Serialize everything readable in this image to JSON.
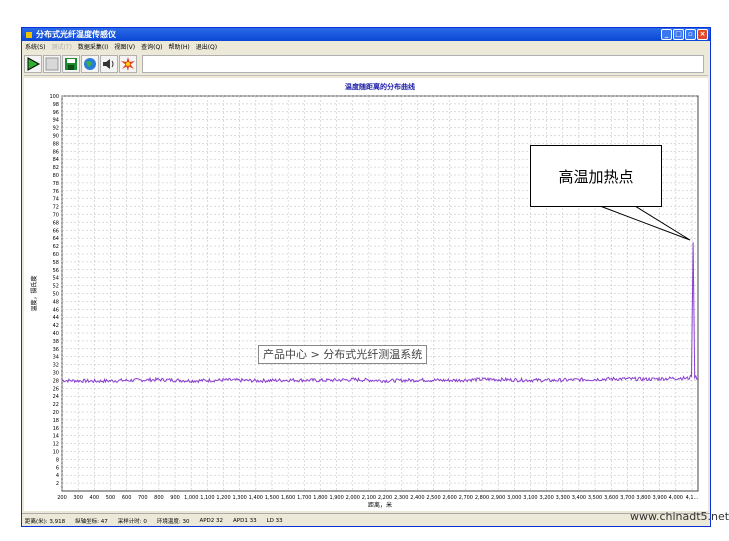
{
  "window": {
    "title": "分布式光纤温度传感仪"
  },
  "menu": [
    {
      "label": "系统(S)",
      "disabled": false
    },
    {
      "label": "测试(T)",
      "disabled": true
    },
    {
      "label": "数据采集(I)",
      "disabled": false
    },
    {
      "label": "视图(V)",
      "disabled": false
    },
    {
      "label": "查询(Q)",
      "disabled": false
    },
    {
      "label": "帮助(H)",
      "disabled": false
    },
    {
      "label": "退出(Q)",
      "disabled": false
    }
  ],
  "toolbar": {
    "buttons": [
      {
        "icon": "play-icon"
      },
      {
        "icon": "stop-icon"
      },
      {
        "icon": "save-icon"
      },
      {
        "icon": "globe-icon"
      },
      {
        "icon": "speaker-icon"
      },
      {
        "icon": "burst-icon"
      }
    ]
  },
  "chart_data": {
    "type": "line",
    "title": "温度随距离的分布曲线",
    "xlabel": "距离，米",
    "ylabel": "温度，摄氏度",
    "xlim": [
      200,
      4100
    ],
    "ylim": [
      0,
      100
    ],
    "x_ticks": [
      "200",
      "300",
      "400",
      "500",
      "600",
      "700",
      "800",
      "900",
      "1,000",
      "1,100",
      "1,200",
      "1,300",
      "1,400",
      "1,500",
      "1,600",
      "1,700",
      "1,800",
      "1,900",
      "2,000",
      "2,100",
      "2,200",
      "2,300",
      "2,400",
      "2,500",
      "2,600",
      "2,700",
      "2,800",
      "2,900",
      "3,000",
      "3,100",
      "3,200",
      "3,300",
      "3,400",
      "3,500",
      "3,600",
      "3,700",
      "3,800",
      "3,900",
      "4,000",
      "4,1..."
    ],
    "y_ticks": [
      2,
      4,
      6,
      8,
      10,
      12,
      14,
      16,
      18,
      20,
      22,
      24,
      26,
      28,
      30,
      32,
      34,
      36,
      38,
      40,
      42,
      44,
      46,
      48,
      50,
      52,
      54,
      56,
      58,
      60,
      62,
      64,
      66,
      68,
      70,
      72,
      74,
      76,
      78,
      80,
      82,
      84,
      86,
      88,
      90,
      92,
      94,
      96,
      98,
      100
    ],
    "grid": true,
    "series": [
      {
        "color": "#8a3fd1",
        "x": [
          200,
          400,
          600,
          800,
          1000,
          1200,
          1400,
          1600,
          1800,
          2000,
          2200,
          2400,
          2600,
          2800,
          3000,
          3200,
          3400,
          3600,
          3800,
          4000,
          4040,
          4060,
          4070,
          4080,
          4100
        ],
        "y": [
          28,
          27.8,
          28,
          28.2,
          27.9,
          28.1,
          27.9,
          28.1,
          28,
          28.2,
          27.9,
          28.1,
          28,
          28.3,
          28.1,
          28,
          28.2,
          28.4,
          28.3,
          28.6,
          28.5,
          29,
          63,
          29,
          28.5
        ]
      }
    ]
  },
  "annotations": {
    "hotspot_label": "高温加热点",
    "breadcrumb": "产品中心 > 分布式光纤测温系统"
  },
  "status": [
    {
      "label": "距离(米): 3,918"
    },
    {
      "label": "纵轴坐标: 47"
    },
    {
      "label": "采样计时: 0"
    },
    {
      "label": "环境温度: 30"
    },
    {
      "label": "APD2  32"
    },
    {
      "label": "APD1  33"
    },
    {
      "label": "LD  33"
    }
  ],
  "watermark": "www.chinadt5.net"
}
